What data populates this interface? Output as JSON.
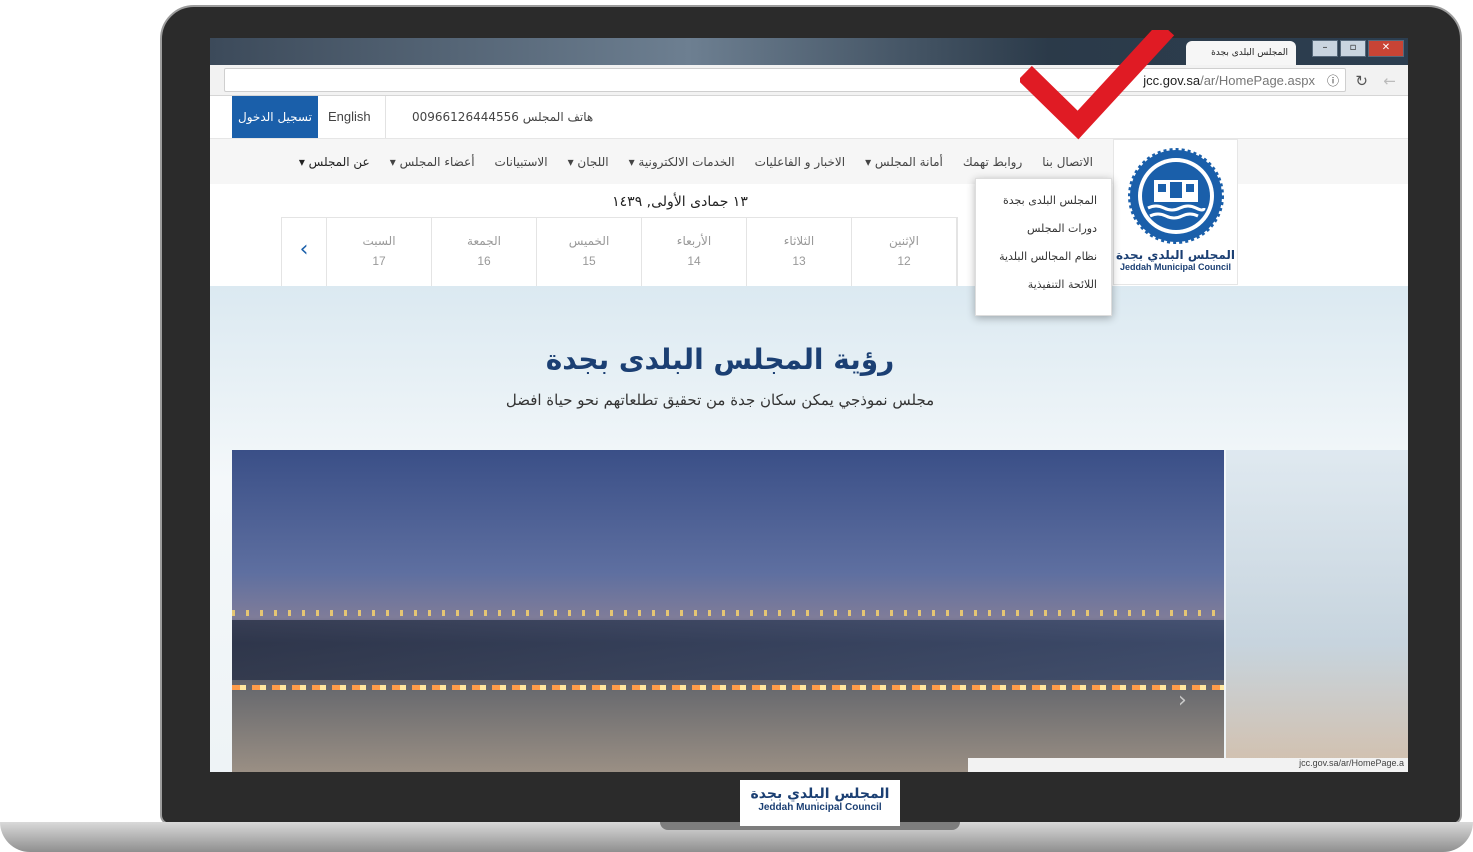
{
  "browser": {
    "tab_title": "المجلس البلدى بجدة",
    "url_host": "jcc.gov.sa",
    "url_path": "/ar/HomePage.aspx",
    "status_url": "jcc.gov.sa/ar/HomePage.a"
  },
  "topbar": {
    "login_label": "تسجيل الدخول",
    "english_label": "English",
    "phone_text": "هاتف المجلس 00966126444556"
  },
  "logo": {
    "ar": "المجلس البلدي بجدة",
    "en": "Jeddah Municipal Council"
  },
  "nav": {
    "items": [
      {
        "label": "عن المجلس ▾"
      },
      {
        "label": "أعضاء المجلس ▾"
      },
      {
        "label": "الاستبيانات"
      },
      {
        "label": "اللجان ▾"
      },
      {
        "label": "الخدمات الالكترونية ▾"
      },
      {
        "label": "الاخبار و الفاعليات"
      },
      {
        "label": "أمانة المجلس ▾"
      },
      {
        "label": "روابط تهمك"
      },
      {
        "label": "الاتصال بنا"
      }
    ]
  },
  "dropdown": {
    "items": [
      {
        "label": "المجلس البلدى بجدة"
      },
      {
        "label": "دورات المجلس"
      },
      {
        "label": "نظام المجالس البلدية"
      },
      {
        "label": "اللائحة التنفيذية"
      }
    ]
  },
  "calendar": {
    "hijri_date": "١٣ جمادى الأولى, ١٤٣٩",
    "days": [
      {
        "name": "السبت",
        "num": "17"
      },
      {
        "name": "الجمعة",
        "num": "16"
      },
      {
        "name": "الخميس",
        "num": "15"
      },
      {
        "name": "الأربعاء",
        "num": "14"
      },
      {
        "name": "الثلاثاء",
        "num": "13"
      },
      {
        "name": "الإثنين",
        "num": "12"
      }
    ],
    "prev_symbol": "‹"
  },
  "vision": {
    "title": "رؤية المجلس البلدى بجدة",
    "subtitle": "مجلس نموذجي يمكن سكان جدة من تحقيق تطلعاتهم نحو حياة افضل"
  },
  "bezel": {
    "ar": "المجلس البلدي بجدة",
    "en": "Jeddah Municipal Council"
  },
  "colors": {
    "accent": "#1a5faa",
    "brand": "#1b3f73",
    "check": "#e01b24"
  }
}
